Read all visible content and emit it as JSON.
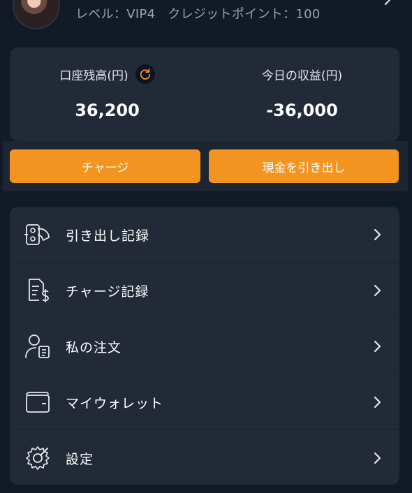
{
  "profile": {
    "avatar_icon": "avatar-photo",
    "level_label": "レベル：VIP4",
    "credit_label": "クレジットポイント：100"
  },
  "balance": {
    "account_label": "口座残高(円)",
    "account_value": "36,200",
    "today_label": "今日の収益(円)",
    "today_value": "-36,000",
    "refresh_icon": "refresh-icon"
  },
  "actions": {
    "charge_label": "チャージ",
    "withdraw_label": "現金を引き出し"
  },
  "menu": {
    "items": [
      {
        "label": "引き出し記録",
        "icon": "withdraw-record-icon"
      },
      {
        "label": "チャージ記録",
        "icon": "charge-record-icon"
      },
      {
        "label": "私の注文",
        "icon": "my-orders-icon"
      },
      {
        "label": "マイウォレット",
        "icon": "wallet-icon"
      },
      {
        "label": "設定",
        "icon": "settings-icon"
      }
    ]
  },
  "colors": {
    "background": "#131a27",
    "card": "#222a38",
    "accent": "#f2941f",
    "text_muted": "#9aa1ad"
  }
}
